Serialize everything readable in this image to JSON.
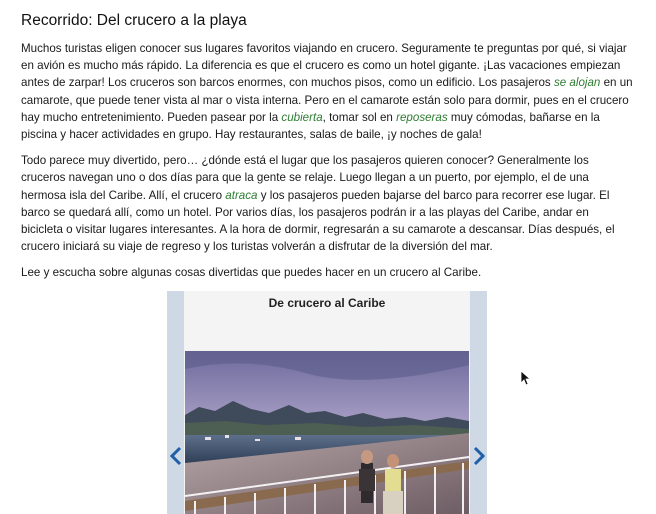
{
  "page": {
    "title": "Recorrido: Del crucero a la playa",
    "p1": {
      "t1": "Muchos turistas eligen conocer sus lugares favoritos viajando en crucero. Seguramente te preguntas por qué, si viajar en avión es mucho más rápido. La diferencia es que el crucero es como un hotel gigante. ¡Las vacaciones empiezan antes de zarpar! Los cruceros son barcos enormes, con muchos pisos, como un edificio. Los pasajeros ",
      "v1": "se alojan",
      "t2": " en un camarote, que puede tener vista al mar o vista interna. Pero en el camarote están solo para dormir, pues en el crucero hay mucho entretenimiento. Pueden pasear por la ",
      "v2": "cubierta",
      "t3": ", tomar sol en ",
      "v3": "reposeras",
      "t4": " muy cómodas, bañarse en la piscina y hacer actividades en grupo. Hay restaurantes, salas de baile, ¡y noches de gala!"
    },
    "p2": {
      "t1": "Todo parece muy divertido, pero… ¿dónde está el lugar que los pasajeros quieren conocer? Generalmente los cruceros navegan uno o dos días para que la gente se relaje. Luego llegan a un puerto, por ejemplo, el de una hermosa isla del Caribe. Allí, el crucero ",
      "v1": "atraca",
      "t2": " y los pasajeros pueden bajarse del barco para recorrer ese lugar. El barco se quedará allí, como un hotel. Por varios días, los pasajeros podrán ir a las playas del Caribe, andar en bicicleta o visitar lugares interesantes. A la hora de dormir, regresarán a su camarote a descansar. Días después, el crucero iniciará su viaje de regreso y los turistas volverán a disfrutar de la diversión del mar."
    },
    "p3": "Lee y escucha sobre algunas cosas divertidas que puedes hacer en un crucero al Caribe."
  },
  "carousel": {
    "slide_title": "De crucero al Caribe",
    "prev_icon": "chevron-left-icon",
    "next_icon": "chevron-right-icon"
  },
  "colors": {
    "vocab": "#2e7d32",
    "carousel_side": "#cfd8e5",
    "arrow": "#1f5fa8"
  }
}
